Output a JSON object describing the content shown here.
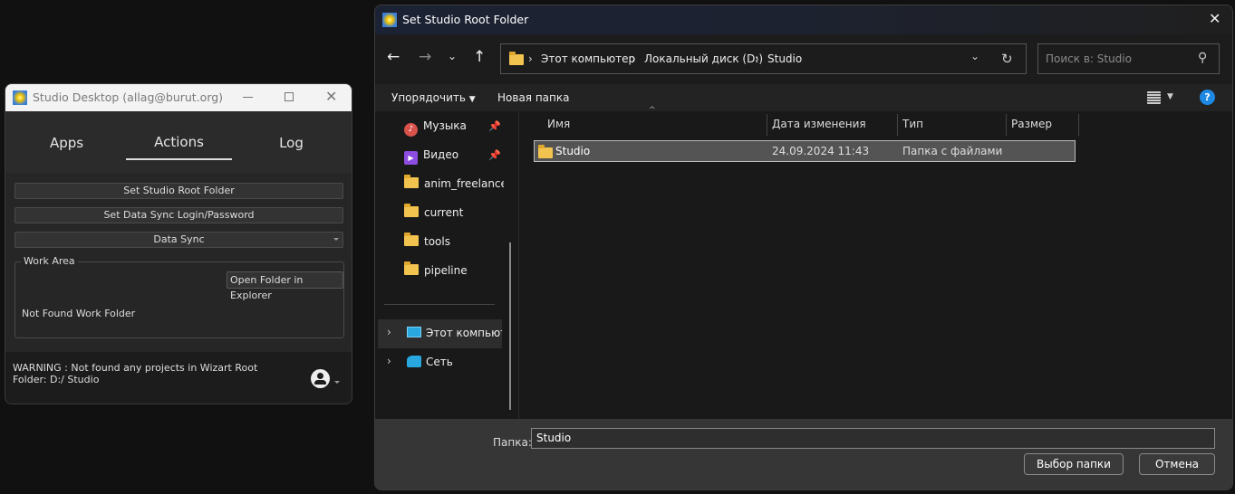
{
  "main_window": {
    "title": "Studio Desktop (allag@burut.org)",
    "tabs": [
      {
        "label": "Apps"
      },
      {
        "label": "Actions",
        "active": true
      },
      {
        "label": "Log"
      }
    ],
    "buttons": {
      "set_root": "Set Studio Root Folder",
      "set_login": "Set Data Sync Login/Password",
      "data_sync": "Data Sync"
    },
    "work_area": {
      "title": "Work Area",
      "open_folder": "Open Folder in Explorer",
      "status": "Not Found Work Folder"
    },
    "warning": "WARNING :  Not found any projects in Wizart Root Folder: D:/ Studio"
  },
  "dialog": {
    "title": "Set Studio Root Folder",
    "breadcrumb": [
      "Этот компьютер",
      "Локальный диск (D:)",
      "Studio"
    ],
    "search_placeholder": "Поиск в: Studio",
    "toolbar": {
      "organize": "Упорядочить",
      "new_folder": "Новая папка"
    },
    "nav_items": [
      {
        "label": "Музыка",
        "icon": "music-icon",
        "pinned": true
      },
      {
        "label": "Видео",
        "icon": "video-icon",
        "pinned": true
      },
      {
        "label": "anim_freelance_",
        "icon": "folder-icon"
      },
      {
        "label": "current",
        "icon": "folder-icon"
      },
      {
        "label": "tools",
        "icon": "folder-icon"
      },
      {
        "label": "pipeline",
        "icon": "folder-icon"
      }
    ],
    "tree_items": [
      {
        "label": "Этот компьютер",
        "icon": "computer-icon",
        "selected": true
      },
      {
        "label": "Сеть",
        "icon": "network-icon"
      }
    ],
    "columns": [
      "Имя",
      "Дата изменения",
      "Тип",
      "Размер"
    ],
    "rows": [
      {
        "name": "Studio",
        "date": "24.09.2024 11:43",
        "type": "Папка с файлами",
        "size": ""
      }
    ],
    "folder_label": "Папка:",
    "folder_value": "Studio",
    "select_button": "Выбор папки",
    "cancel_button": "Отмена"
  }
}
